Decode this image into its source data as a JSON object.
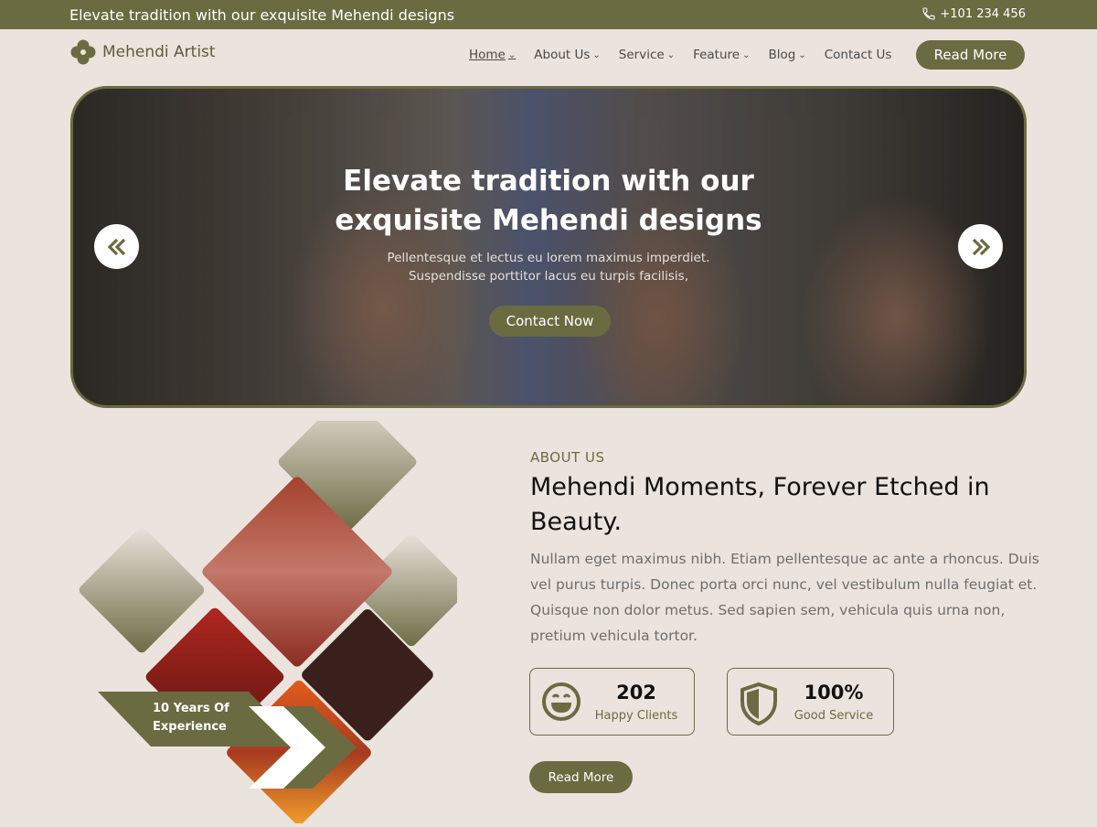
{
  "topbar": {
    "tagline": "Elevate tradition with our exquisite Mehendi designs",
    "phone": "+101 234 456"
  },
  "header": {
    "logo_text": "Mehendi Artist",
    "nav": [
      {
        "label": "Home",
        "dropdown": true,
        "active": true
      },
      {
        "label": "About Us",
        "dropdown": true
      },
      {
        "label": "Service",
        "dropdown": true
      },
      {
        "label": "Feature",
        "dropdown": true
      },
      {
        "label": "Blog",
        "dropdown": true
      },
      {
        "label": "Contact Us",
        "dropdown": false
      }
    ],
    "cta_label": "Read More"
  },
  "hero": {
    "title_line1": "Elevate tradition with our",
    "title_line2": "exquisite Mehendi designs",
    "sub_line1": "Pellentesque et lectus eu lorem maximus imperdiet.",
    "sub_line2": "Suspendisse porttitor lacus eu turpis facilisis,",
    "button_label": "Contact Now"
  },
  "collage": {
    "badge_line1": "10 Years Of",
    "badge_line2": "Experience"
  },
  "about": {
    "label": "ABOUT US",
    "title": "Mehendi Moments, Forever Etched in Beauty.",
    "text": "Nullam eget maximus nibh. Etiam pellentesque ac ante a rhoncus. Duis vel purus turpis. Donec porta orci nunc, vel vestibulum nulla feugiat et. Quisque non dolor metus. Sed sapien sem, vehicula quis urna non, pretium vehicula tortor.",
    "stats": [
      {
        "value": "202",
        "label": "Happy Clients",
        "icon": "smile-icon"
      },
      {
        "value": "100%",
        "label": "Good Service",
        "icon": "shield-icon"
      }
    ],
    "button_label": "Read More"
  },
  "colors": {
    "accent": "#6b6b42",
    "background": "#ebe3dd"
  }
}
